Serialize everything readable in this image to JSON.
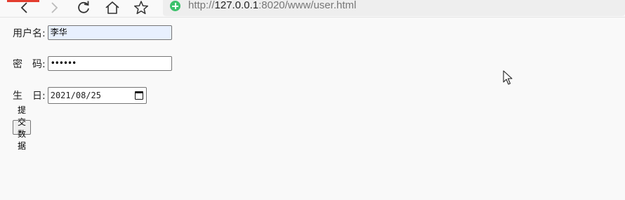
{
  "browser": {
    "url_prefix": "http://",
    "url_host": "127.0.0.1",
    "url_rest": ":8020/www/user.html"
  },
  "icons": {
    "back": "arrow-left-icon",
    "forward": "arrow-right-icon",
    "reload": "reload-icon",
    "home": "home-icon",
    "bookmark": "star-icon",
    "security": "shield-icon"
  },
  "form": {
    "username_label": "用户名:",
    "username_value": "李华",
    "password_label": "密　码:",
    "password_value": "••••••",
    "birthday_label": "生　日:",
    "birthday_value": "2021/08/25",
    "submit_label": "提交数据"
  }
}
